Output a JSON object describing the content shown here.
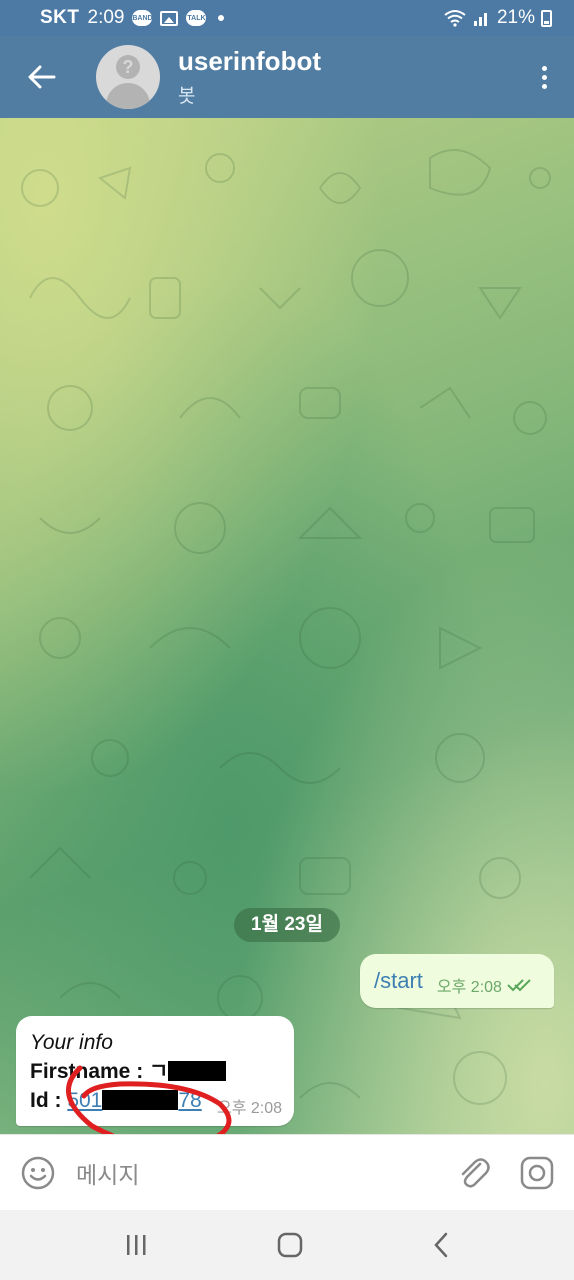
{
  "status_bar": {
    "carrier": "SKT",
    "time": "2:09",
    "notification_icons": [
      "band-icon",
      "gallery-icon",
      "talk-icon"
    ],
    "notif_band": "BAND",
    "notif_talk": "TALK",
    "signal_icons": [
      "wifi-icon",
      "cell-signal-icon"
    ],
    "battery_percent": "21%"
  },
  "header": {
    "title": "userinfobot",
    "subtitle": "봇",
    "avatar_glyph": "?"
  },
  "chat": {
    "date_label": "1월 23일",
    "outgoing": {
      "text": "/start",
      "time": "오후 2:08",
      "status": "read"
    },
    "incoming": {
      "line1": "Your info",
      "firstname_label": "Firstname : ",
      "firstname_value_visible": "ㄱ",
      "id_label": "Id : ",
      "id_prefix": "501",
      "id_suffix": "78",
      "time": "오후 2:08"
    }
  },
  "input": {
    "placeholder": "메시지"
  },
  "colors": {
    "header": "#517da2",
    "status_bar": "#4c7aa4",
    "outgoing_bubble": "#effdde",
    "link": "#3d7fb3",
    "annotation": "#e02020"
  }
}
